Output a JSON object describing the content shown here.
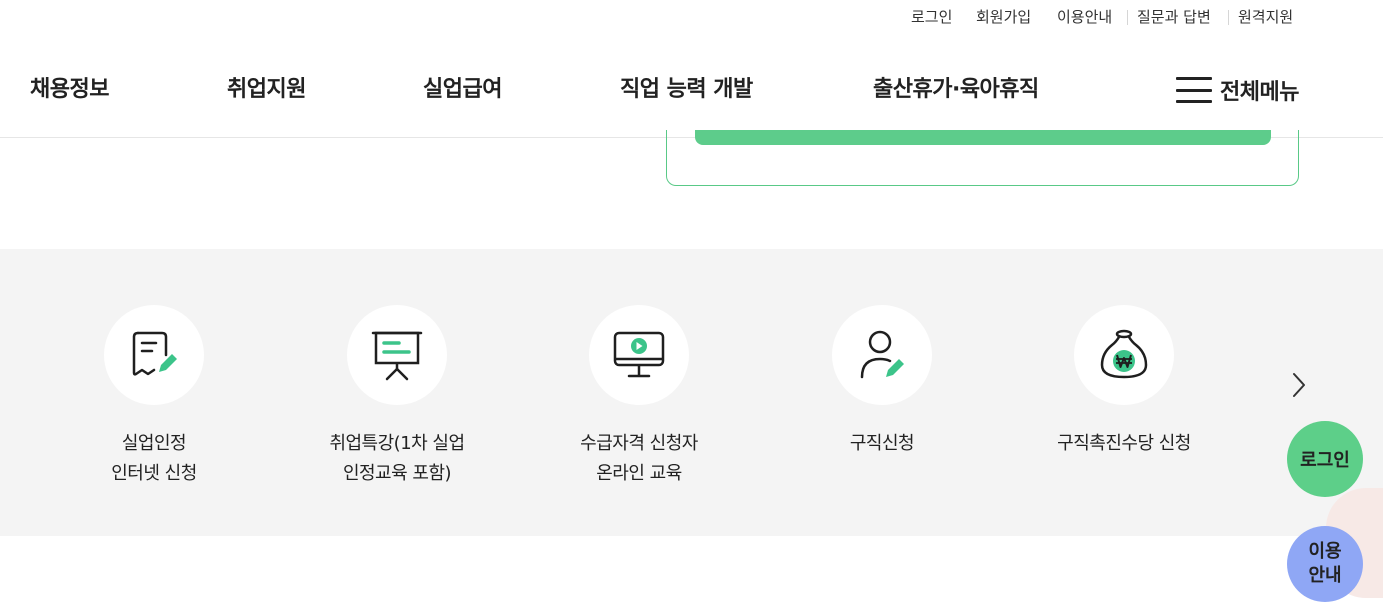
{
  "util_links": [
    "로그인",
    "회원가입",
    "이용안내",
    "질문과 답변",
    "원격지원"
  ],
  "main_nav": {
    "items": [
      "채용정보",
      "취업지원",
      "실업급여",
      "직업 능력 개발",
      "출산휴가·육아휴직"
    ],
    "full_menu_label": "전체메뉴"
  },
  "quick_menu": [
    {
      "icon": "document-edit-icon",
      "lines": [
        "실업인정",
        "인터넷 신청"
      ]
    },
    {
      "icon": "presentation-board-icon",
      "lines": [
        "취업특강(1차 실업",
        "인정교육 포함)"
      ]
    },
    {
      "icon": "monitor-play-icon",
      "lines": [
        "수급자격 신청자",
        "온라인 교육"
      ]
    },
    {
      "icon": "person-edit-icon",
      "lines": [
        "구직신청"
      ]
    },
    {
      "icon": "money-bag-won-icon",
      "lines": [
        "구직촉진수당 신청"
      ]
    }
  ],
  "floating": {
    "login_label": "로그인",
    "guide_lines": [
      "이용",
      "안내"
    ]
  },
  "colors": {
    "accent_green": "#5dcc8b",
    "icon_green": "#3cc48a",
    "guide_blue": "#8fa7f5",
    "section_bg": "#f4f4f4"
  }
}
